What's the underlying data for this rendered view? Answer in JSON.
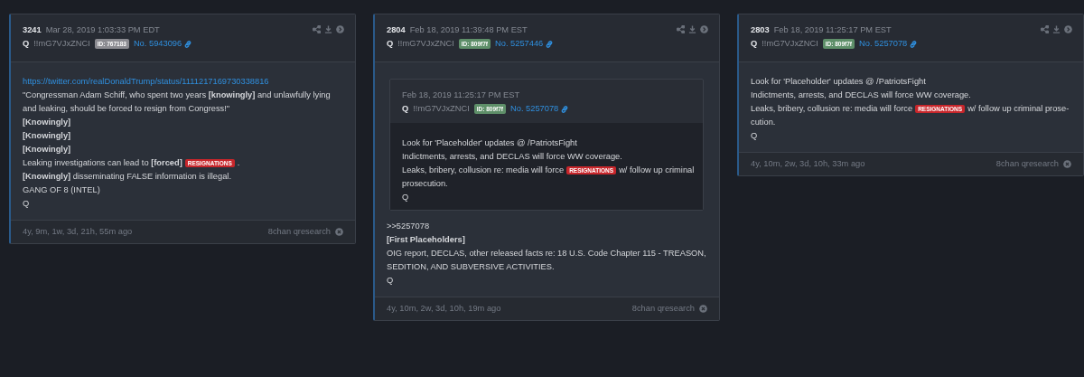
{
  "posts": [
    {
      "number": "3241",
      "date": "Mar 28, 2019 1:03:33 PM EDT",
      "author": "Q",
      "tripcode": "!!mG7VJxZNCI",
      "id": {
        "text": "ID: 767183",
        "color": "#8b8b91"
      },
      "post_no": "No. 5943096",
      "body": [
        [
          {
            "kind": "link",
            "text": "https://twitter.com/realDonaldTrump/status/1111217169730338816"
          }
        ],
        [
          {
            "kind": "text",
            "text": "\"Congressman Adam Schiff, who spent two years **[knowingly]** and unlawfully lying and leaking, should be forced to resign from Congress!\""
          }
        ],
        [
          {
            "kind": "text",
            "text": "**[Knowingly]**"
          }
        ],
        [
          {
            "kind": "text",
            "text": "**[Knowingly]**"
          }
        ],
        [
          {
            "kind": "text",
            "text": "**[Knowingly]**"
          }
        ],
        [
          {
            "kind": "text",
            "text": "Leaking investigations can lead to **[forced]**"
          },
          {
            "kind": "tag",
            "text": "RESIGNATIONS"
          },
          {
            "kind": "text",
            "text": "."
          }
        ],
        [
          {
            "kind": "text",
            "text": "**[Knowingly]** disseminating FALSE information is illegal."
          }
        ],
        [
          {
            "kind": "text",
            "text": "GANG OF 8 (INTEL)"
          }
        ],
        [
          {
            "kind": "text",
            "text": "Q"
          }
        ]
      ],
      "time_ago": "4y, 9m, 1w, 3d, 21h, 55m ago",
      "source": "8chan qresearch"
    },
    {
      "number": "2804",
      "date": "Feb 18, 2019 11:39:48 PM EST",
      "author": "Q",
      "tripcode": "!!mG7VJxZNCI",
      "id": {
        "text": "ID: 809f7f",
        "color": "#5e8f69"
      },
      "post_no": "No. 5257446",
      "quote": {
        "date": "Feb 18, 2019 11:25:17 PM EST",
        "author": "Q",
        "tripcode": "!!mG7VJxZNCI",
        "id": {
          "text": "ID: 809f7f",
          "color": "#5e8f69"
        },
        "post_no": "No. 5257078",
        "body": [
          [
            {
              "kind": "text",
              "text": "Look for 'Placeholder' updates @ /PatriotsFight"
            }
          ],
          [
            {
              "kind": "text",
              "text": "Indictments, arrests, and DECLAS will force WW coverage."
            }
          ],
          [
            {
              "kind": "text",
              "text": "Leaks, bribery, collusion re: media will force"
            },
            {
              "kind": "tag",
              "text": "RESIGNATIONS"
            },
            {
              "kind": "text",
              "text": "w/ follow up criminal"
            }
          ],
          [
            {
              "kind": "text",
              "text": "prosecution."
            }
          ],
          [
            {
              "kind": "text",
              "text": "Q"
            }
          ]
        ]
      },
      "body": [
        [
          {
            "kind": "text",
            "text": ">>5257078"
          }
        ],
        [
          {
            "kind": "text",
            "text": "**[First Placeholders]**"
          }
        ],
        [
          {
            "kind": "text",
            "text": "OIG report, DECLAS, other released facts re: 18 U.S. Code Chapter 115 - TREASON, SEDITION, AND SUBVERSIVE ACTIVITIES."
          }
        ],
        [
          {
            "kind": "text",
            "text": "Q"
          }
        ]
      ],
      "time_ago": "4y, 10m, 2w, 3d, 10h, 19m ago",
      "source": "8chan qresearch"
    },
    {
      "number": "2803",
      "date": "Feb 18, 2019 11:25:17 PM EST",
      "author": "Q",
      "tripcode": "!!mG7VJxZNCI",
      "id": {
        "text": "ID: 809f7f",
        "color": "#5e8f69"
      },
      "post_no": "No. 5257078",
      "body": [
        [
          {
            "kind": "text",
            "text": "Look for 'Placeholder' updates @ /PatriotsFight"
          }
        ],
        [
          {
            "kind": "text",
            "text": "Indictments, arrests, and DECLAS will force WW coverage."
          }
        ],
        [
          {
            "kind": "text",
            "text": "Leaks, bribery, collusion re: media will force"
          },
          {
            "kind": "tag",
            "text": "RESIGNATIONS"
          },
          {
            "kind": "text",
            "text": "w/ follow up criminal prose-"
          }
        ],
        [
          {
            "kind": "text",
            "text": "cution."
          }
        ],
        [
          {
            "kind": "text",
            "text": "Q"
          }
        ]
      ],
      "time_ago": "4y, 10m, 2w, 3d, 10h, 33m ago",
      "source": "8chan qresearch"
    }
  ]
}
